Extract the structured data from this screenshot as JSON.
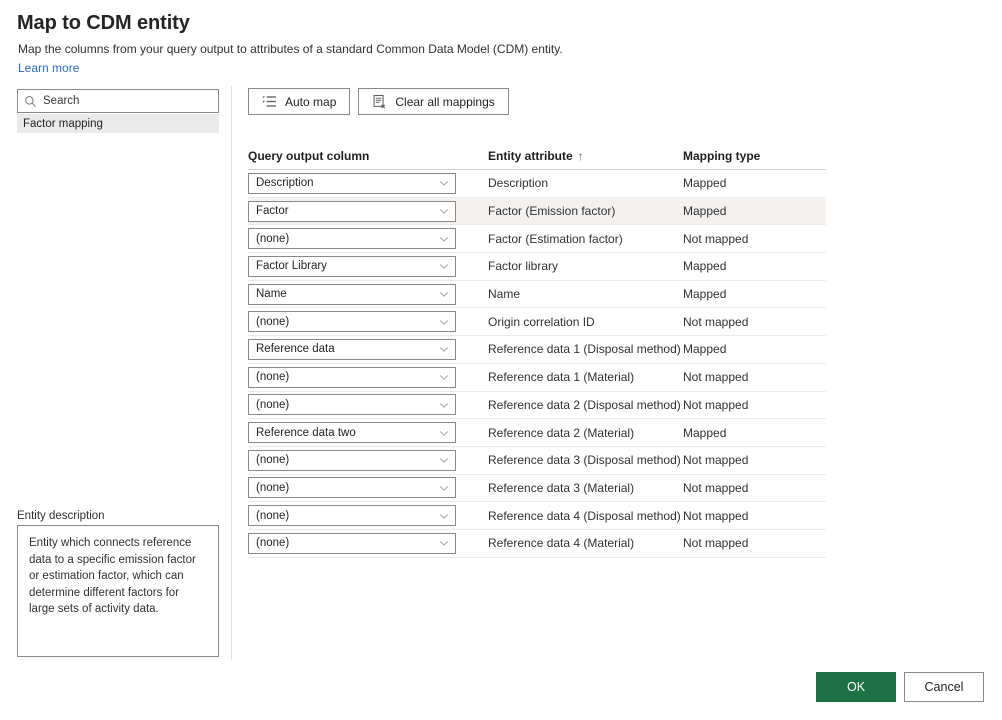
{
  "header": {
    "title": "Map to CDM entity",
    "subtitle": "Map the columns from your query output to attributes of a standard Common Data Model (CDM) entity.",
    "learn_more": "Learn more"
  },
  "sidebar": {
    "search_placeholder": "Search",
    "search_value": "",
    "items": [
      {
        "label": "Factor mapping",
        "selected": true
      }
    ],
    "entity_description_label": "Entity description",
    "entity_description_text": "Entity which connects reference data to a specific emission factor or estimation factor, which can determine different factors for large sets of activity data."
  },
  "toolbar": {
    "auto_map_label": "Auto map",
    "auto_map_icon": "auto-map-icon",
    "clear_all_label": "Clear all mappings",
    "clear_all_icon": "clear-mappings-icon"
  },
  "table": {
    "columns": {
      "query_output_column": "Query output column",
      "entity_attribute": "Entity attribute",
      "entity_attribute_sort": "↑",
      "mapping_type": "Mapping type"
    },
    "rows": [
      {
        "query_output_column": "Description",
        "entity_attribute": "Description",
        "mapping_type": "Mapped",
        "selected": false
      },
      {
        "query_output_column": "Factor",
        "entity_attribute": "Factor (Emission factor)",
        "mapping_type": "Mapped",
        "selected": true
      },
      {
        "query_output_column": "(none)",
        "entity_attribute": "Factor (Estimation factor)",
        "mapping_type": "Not mapped",
        "selected": false
      },
      {
        "query_output_column": "Factor Library",
        "entity_attribute": "Factor library",
        "mapping_type": "Mapped",
        "selected": false
      },
      {
        "query_output_column": "Name",
        "entity_attribute": "Name",
        "mapping_type": "Mapped",
        "selected": false
      },
      {
        "query_output_column": "(none)",
        "entity_attribute": "Origin correlation ID",
        "mapping_type": "Not mapped",
        "selected": false
      },
      {
        "query_output_column": "Reference data",
        "entity_attribute": "Reference data 1 (Disposal method)",
        "mapping_type": "Mapped",
        "selected": false
      },
      {
        "query_output_column": "(none)",
        "entity_attribute": "Reference data 1 (Material)",
        "mapping_type": "Not mapped",
        "selected": false
      },
      {
        "query_output_column": "(none)",
        "entity_attribute": "Reference data 2 (Disposal method)",
        "mapping_type": "Not mapped",
        "selected": false
      },
      {
        "query_output_column": "Reference data two",
        "entity_attribute": "Reference data 2 (Material)",
        "mapping_type": "Mapped",
        "selected": false
      },
      {
        "query_output_column": "(none)",
        "entity_attribute": "Reference data 3 (Disposal method)",
        "mapping_type": "Not mapped",
        "selected": false
      },
      {
        "query_output_column": "(none)",
        "entity_attribute": "Reference data 3 (Material)",
        "mapping_type": "Not mapped",
        "selected": false
      },
      {
        "query_output_column": "(none)",
        "entity_attribute": "Reference data 4 (Disposal method)",
        "mapping_type": "Not mapped",
        "selected": false
      },
      {
        "query_output_column": "(none)",
        "entity_attribute": "Reference data 4 (Material)",
        "mapping_type": "Not mapped",
        "selected": false
      }
    ]
  },
  "footer": {
    "ok_label": "OK",
    "cancel_label": "Cancel"
  },
  "colors": {
    "primary_button": "#1e7145",
    "link": "#2b6cb8",
    "selected_row": "#f3f2f1",
    "sidebar_selected": "#eaeaea"
  }
}
